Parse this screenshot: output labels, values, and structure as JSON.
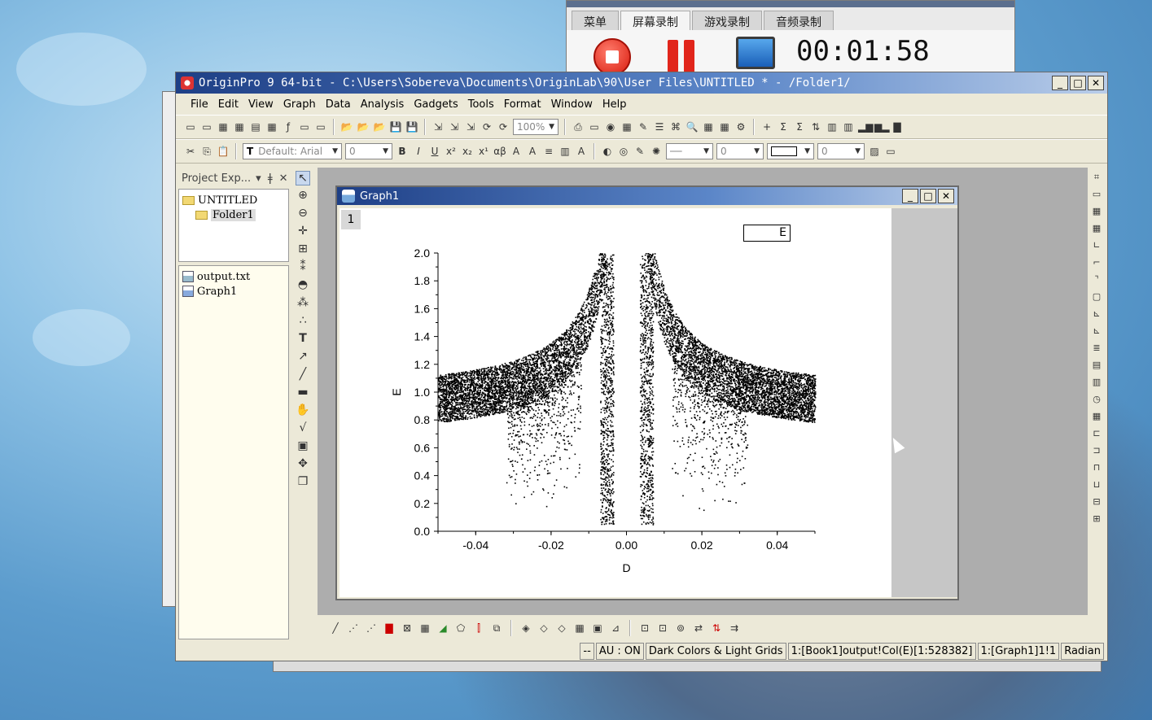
{
  "recorder": {
    "tabs": [
      "菜单",
      "屏幕录制",
      "游戏录制",
      "音频录制"
    ],
    "active_tab": "屏幕录制",
    "timer": "00:01:58"
  },
  "window": {
    "title": "OriginPro 9 64-bit - C:\\Users\\Sobereva\\Documents\\OriginLab\\90\\User Files\\UNTITLED * - /Folder1/",
    "menu": [
      "File",
      "Edit",
      "View",
      "Graph",
      "Data",
      "Analysis",
      "Gadgets",
      "Tools",
      "Format",
      "Window",
      "Help"
    ]
  },
  "toolbar": {
    "zoom": "100%",
    "font": "Default: Arial",
    "font_size": "0",
    "line_width": "0",
    "pattern_size": "0"
  },
  "project_explorer": {
    "title": "Project Exp...",
    "root": "UNTITLED",
    "folder": "Folder1",
    "files": [
      "output.txt",
      "Graph1"
    ]
  },
  "graph": {
    "title": "Graph1",
    "layer": "1",
    "legend": "E"
  },
  "chart_data": {
    "type": "scatter",
    "xlabel": "D",
    "ylabel": "E",
    "xlim": [
      -0.05,
      0.05
    ],
    "ylim": [
      0.0,
      2.0
    ],
    "xticks": [
      "-0.04",
      "-0.02",
      "0.00",
      "0.02",
      "0.04"
    ],
    "yticks": [
      "0.0",
      "0.2",
      "0.4",
      "0.6",
      "0.8",
      "1.0",
      "1.2",
      "1.4",
      "1.6",
      "1.8",
      "2.0"
    ],
    "series": [
      {
        "name": "E",
        "color": "#000000",
        "description_points": [
          [
            -0.05,
            0.8
          ],
          [
            -0.05,
            1.15
          ],
          [
            -0.04,
            0.87
          ],
          [
            -0.04,
            1.22
          ],
          [
            -0.03,
            0.95
          ],
          [
            -0.03,
            1.3
          ],
          [
            -0.02,
            1.07
          ],
          [
            -0.02,
            1.42
          ],
          [
            -0.01,
            1.3
          ],
          [
            -0.01,
            1.7
          ],
          [
            -0.005,
            1.5
          ],
          [
            -0.005,
            2.0
          ],
          [
            0.005,
            2.0
          ],
          [
            0.01,
            1.7
          ],
          [
            0.01,
            1.3
          ],
          [
            0.02,
            1.45
          ],
          [
            0.02,
            1.07
          ],
          [
            0.03,
            1.3
          ],
          [
            0.03,
            0.95
          ],
          [
            0.04,
            1.2
          ],
          [
            0.04,
            0.87
          ],
          [
            0.05,
            1.12
          ],
          [
            0.05,
            0.78
          ],
          [
            -0.005,
            0.1
          ],
          [
            0.005,
            0.1
          ],
          [
            0.02,
            0.05
          ],
          [
            -0.025,
            0.2
          ]
        ]
      }
    ]
  },
  "status": [
    "--",
    "AU : ON",
    "Dark Colors & Light Grids",
    "1:[Book1]output!Col(E)[1:528382]",
    "1:[Graph1]1!1",
    "Radian"
  ],
  "colors": {
    "titlebar": "#1e3f86",
    "chrome": "#ece9d8",
    "workspace": "#adadad"
  }
}
